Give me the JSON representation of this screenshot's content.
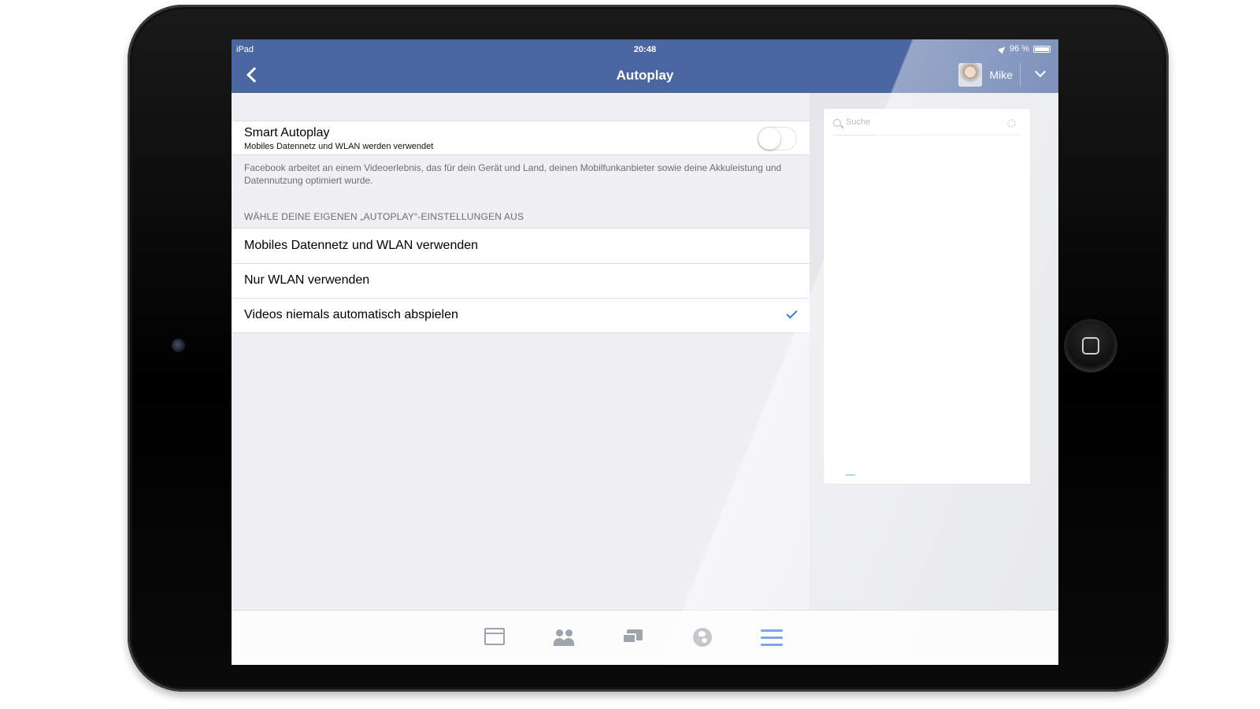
{
  "status_bar": {
    "carrier": "iPad",
    "time": "20:48",
    "battery": "96 %"
  },
  "nav": {
    "title": "Autoplay",
    "profile_name": "Mike"
  },
  "smart_autoplay": {
    "title": "Smart Autoplay",
    "subtitle": "Mobiles Datennetz und WLAN werden verwendet",
    "enabled": false,
    "footer": "Facebook arbeitet an einem Videoerlebnis, das für dein Gerät und Land, deinen Mobilfunkanbieter sowie deine Akkuleistung und Datennutzung optimiert wurde."
  },
  "options_section": {
    "header": "WÄHLE DEINE EIGENEN „AUTOPLAY“-EINSTELLUNGEN AUS",
    "items": [
      {
        "label": "Mobiles Datennetz und WLAN verwenden",
        "selected": false
      },
      {
        "label": "Nur WLAN verwenden",
        "selected": false
      },
      {
        "label": "Videos niemals automatisch abspielen",
        "selected": true
      }
    ]
  },
  "sidebar": {
    "search_placeholder": "Suche"
  },
  "tabbar": {
    "icons": [
      "news-feed-icon",
      "friends-icon",
      "messages-icon",
      "notifications-globe-icon",
      "more-menu-icon"
    ],
    "active": "more-menu-icon",
    "active_color": "#3b7ae0"
  },
  "colors": {
    "nav_background": "#4b67a1",
    "checkmark": "#3a7be4"
  }
}
